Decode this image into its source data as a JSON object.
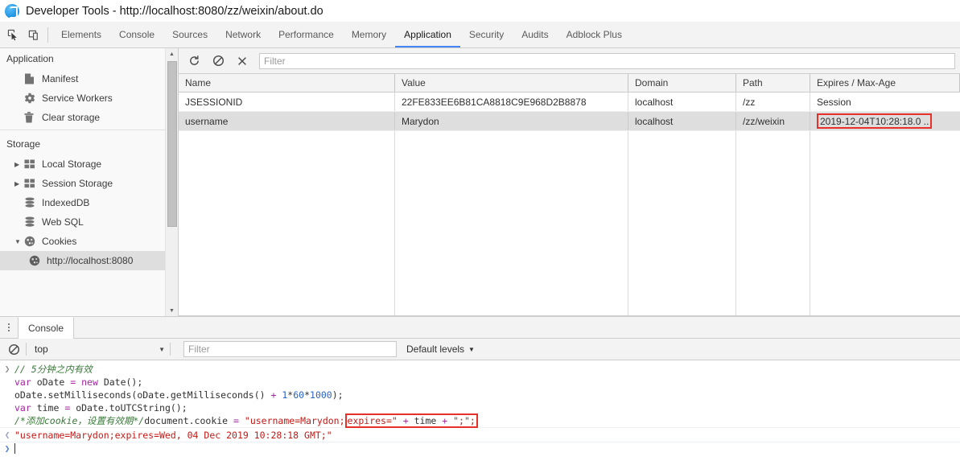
{
  "window": {
    "title": "Developer Tools - http://localhost:8080/zz/weixin/about.do",
    "app_icon": "devtools-blue-icon"
  },
  "tabstrip": {
    "icons": [
      {
        "name": "inspect-element-icon",
        "glyph": "cursor-box"
      },
      {
        "name": "toggle-device-toolbar-icon",
        "glyph": "device-frames"
      }
    ],
    "tabs": [
      {
        "label": "Elements",
        "active": false
      },
      {
        "label": "Console",
        "active": false
      },
      {
        "label": "Sources",
        "active": false
      },
      {
        "label": "Network",
        "active": false
      },
      {
        "label": "Performance",
        "active": false
      },
      {
        "label": "Memory",
        "active": false
      },
      {
        "label": "Application",
        "active": true
      },
      {
        "label": "Security",
        "active": false
      },
      {
        "label": "Audits",
        "active": false
      },
      {
        "label": "Adblock Plus",
        "active": false
      }
    ],
    "active_accent": "#4285f4"
  },
  "sidebar": {
    "sections": [
      {
        "title": "Application",
        "items": [
          {
            "label": "Manifest",
            "icon": "manifest-file-icon",
            "twisty": "",
            "indent": 1,
            "selected": false
          },
          {
            "label": "Service Workers",
            "icon": "gear-icon",
            "twisty": "",
            "indent": 1,
            "selected": false
          },
          {
            "label": "Clear storage",
            "icon": "trash-icon",
            "twisty": "",
            "indent": 1,
            "selected": false
          }
        ]
      },
      {
        "title": "Storage",
        "items": [
          {
            "label": "Local Storage",
            "icon": "table-grid-icon",
            "twisty": "▶",
            "indent": 1,
            "selected": false
          },
          {
            "label": "Session Storage",
            "icon": "table-grid-icon",
            "twisty": "▶",
            "indent": 1,
            "selected": false
          },
          {
            "label": "IndexedDB",
            "icon": "database-icon",
            "twisty": "",
            "indent": 1,
            "selected": false
          },
          {
            "label": "Web SQL",
            "icon": "database-icon",
            "twisty": "",
            "indent": 1,
            "selected": false
          },
          {
            "label": "Cookies",
            "icon": "cookie-icon",
            "twisty": "▼",
            "indent": 1,
            "selected": false
          },
          {
            "label": "http://localhost:8080",
            "icon": "cookie-icon",
            "twisty": "",
            "indent": 2,
            "selected": true
          }
        ]
      }
    ],
    "scrollbar": {
      "up_arrow": "▲",
      "down_arrow": "▼"
    }
  },
  "cookie_panel": {
    "toolbar": {
      "refresh_icon": "refresh-icon",
      "clear_all_icon": "block-clear-icon",
      "delete_icon": "close-x-icon",
      "filter_placeholder": "Filter",
      "filter_value": ""
    },
    "columns": [
      {
        "key": "name",
        "label": "Name"
      },
      {
        "key": "value",
        "label": "Value"
      },
      {
        "key": "domain",
        "label": "Domain"
      },
      {
        "key": "path",
        "label": "Path"
      },
      {
        "key": "expires",
        "label": "Expires / Max-Age"
      }
    ],
    "rows": [
      {
        "name": "JSESSIONID",
        "value": "22FE833EE6B81CA8818C9E968D2B8878",
        "domain": "localhost",
        "path": "/zz",
        "expires": "Session",
        "selected": false,
        "expires_highlighted": false
      },
      {
        "name": "username",
        "value": "Marydon",
        "domain": "localhost",
        "path": "/zz/weixin",
        "expires": "2019-12-04T10:28:18.0 ..",
        "selected": true,
        "expires_highlighted": true
      }
    ],
    "highlight_color": "#e8302a"
  },
  "drawer": {
    "kebab_icon": "more-options-icon",
    "tabs": [
      {
        "label": "Console",
        "active": true
      }
    ],
    "toolbar": {
      "clear_icon": "clear-console-icon",
      "context": "top",
      "context_caret": "▼",
      "filter_placeholder": "Filter",
      "filter_value": "",
      "levels_label": "Default levels",
      "levels_caret": "▼"
    },
    "console": {
      "input_gutter": "❯",
      "output_gutter": "❮",
      "prompt_gutter": "❯",
      "input_lines": [
        {
          "parts": [
            {
              "t": "// 5分钟之内有效",
              "c": "com"
            }
          ]
        },
        {
          "parts": [
            {
              "t": "var ",
              "c": "kw"
            },
            {
              "t": "oDate ",
              "c": "plain"
            },
            {
              "t": "= ",
              "c": "kw"
            },
            {
              "t": "new ",
              "c": "kw"
            },
            {
              "t": "Date();",
              "c": "plain"
            }
          ]
        },
        {
          "parts": [
            {
              "t": "oDate.setMilliseconds(oDate.getMilliseconds() ",
              "c": "plain"
            },
            {
              "t": "+ ",
              "c": "kw"
            },
            {
              "t": "1",
              "c": "num"
            },
            {
              "t": "*",
              "c": "plain"
            },
            {
              "t": "60",
              "c": "num"
            },
            {
              "t": "*",
              "c": "plain"
            },
            {
              "t": "1000",
              "c": "num"
            },
            {
              "t": ");",
              "c": "plain"
            }
          ]
        },
        {
          "parts": [
            {
              "t": "var ",
              "c": "kw"
            },
            {
              "t": "time ",
              "c": "plain"
            },
            {
              "t": "= ",
              "c": "kw"
            },
            {
              "t": "oDate.toUTCString();",
              "c": "plain"
            }
          ]
        },
        {
          "parts": [
            {
              "t": "/*添加cookie，设置有效期*/",
              "c": "com"
            },
            {
              "t": "document.cookie ",
              "c": "plain"
            },
            {
              "t": "= ",
              "c": "kw"
            },
            {
              "t": "\"username=Marydon;",
              "c": "str"
            },
            {
              "t": "expires=\" ",
              "c": "str",
              "hl": true
            },
            {
              "t": "+ ",
              "c": "kw",
              "hl": true
            },
            {
              "t": "time ",
              "c": "plain",
              "hl": true
            },
            {
              "t": "+ ",
              "c": "kw",
              "hl": true
            },
            {
              "t": "\";\";",
              "c": "str",
              "hl": true
            }
          ]
        }
      ],
      "result": "\"username=Marydon;expires=Wed, 04 Dec 2019 10:28:18 GMT;\""
    }
  }
}
